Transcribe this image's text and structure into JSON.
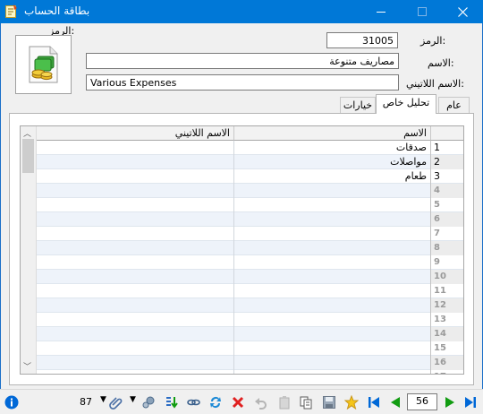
{
  "window": {
    "title": "بطاقة الحساب",
    "colors": {
      "title_bar": "#0078d7",
      "frame": "#f0f0f0",
      "accent_green": "#119c11",
      "accent_blue": "#0068d7",
      "close_red": "#e02020"
    }
  },
  "header": {
    "code_caption": "الرمز:",
    "code_label": "الرمز:",
    "code_value": "31005",
    "name_label": "الاسم:",
    "name_value": "مصاريف متنوعة",
    "latin_label": "الاسم اللاتيني:",
    "latin_value": "Various Expenses",
    "account_icon": "coins-document-icon"
  },
  "tabs": [
    {
      "label": "عام",
      "active": false
    },
    {
      "label": "تحليل خاص",
      "active": true
    },
    {
      "label": "خيارات",
      "active": false
    }
  ],
  "grid": {
    "columns": {
      "name": "الاسم",
      "latin": "الاسم اللاتيني"
    },
    "rows": [
      {
        "num": "1",
        "name": "صدقات",
        "latin": ""
      },
      {
        "num": "2",
        "name": "مواصلات",
        "latin": ""
      },
      {
        "num": "3",
        "name": "طعام",
        "latin": ""
      },
      {
        "num": "4",
        "name": "",
        "latin": ""
      },
      {
        "num": "5",
        "name": "",
        "latin": ""
      },
      {
        "num": "6",
        "name": "",
        "latin": ""
      },
      {
        "num": "7",
        "name": "",
        "latin": ""
      },
      {
        "num": "8",
        "name": "",
        "latin": ""
      },
      {
        "num": "9",
        "name": "",
        "latin": ""
      },
      {
        "num": "10",
        "name": "",
        "latin": ""
      },
      {
        "num": "11",
        "name": "",
        "latin": ""
      },
      {
        "num": "12",
        "name": "",
        "latin": ""
      },
      {
        "num": "13",
        "name": "",
        "latin": ""
      },
      {
        "num": "14",
        "name": "",
        "latin": ""
      },
      {
        "num": "15",
        "name": "",
        "latin": ""
      },
      {
        "num": "16",
        "name": "",
        "latin": ""
      },
      {
        "num": "17",
        "name": "",
        "latin": ""
      }
    ]
  },
  "statusbar": {
    "info_icon": "info-icon",
    "count": "87",
    "current_record": "56",
    "tools": [
      "attach-icon",
      "tools-icon",
      "sort-down-icon",
      "link-icon",
      "refresh-icon",
      "delete-icon",
      "undo-icon",
      "copy-icon",
      "paste-icon",
      "save-icon",
      "favorite-icon",
      "first-record-icon",
      "prev-record-icon",
      "next-record-icon",
      "last-record-icon"
    ]
  }
}
